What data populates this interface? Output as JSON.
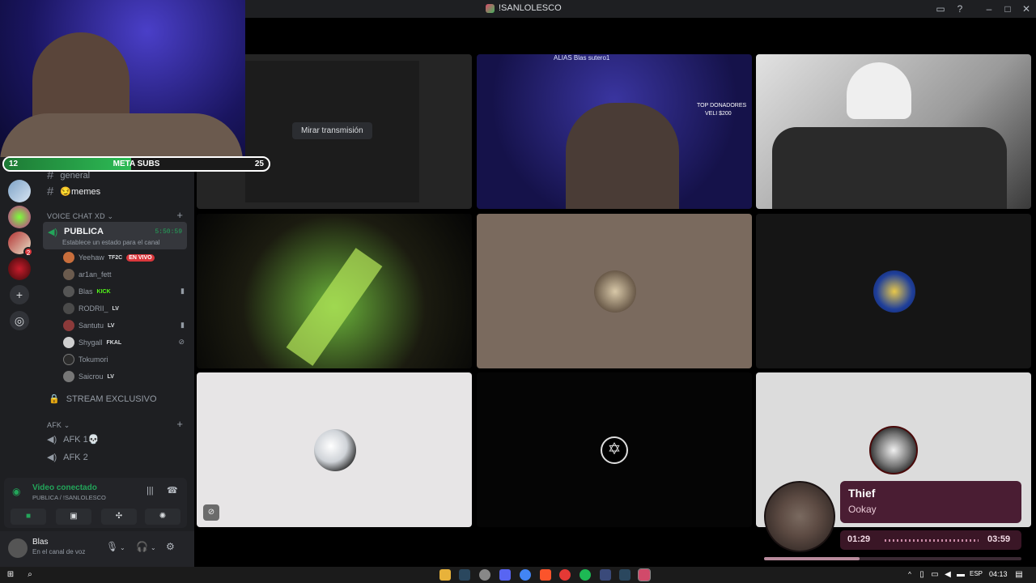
{
  "window": {
    "title": "!SANLOLESCO"
  },
  "overlay": {
    "meta_label": "META SUBS",
    "meta_current": "12",
    "meta_goal": "25",
    "meta_progress": 0.48
  },
  "channels": {
    "text": [
      {
        "label": "general"
      },
      {
        "label": "😏memes"
      }
    ],
    "voice_category": "VOICE CHAT XD",
    "active_voice": {
      "name": "PUBLICA",
      "time": "5:50:59",
      "status": "Establece un estado para el canal"
    },
    "members": [
      {
        "name": "Yeehaw",
        "tag": "TF2C",
        "live": "EN VIVO",
        "color": "#c86e3c"
      },
      {
        "name": "ar1an_fett",
        "tag": "",
        "live": "",
        "color": "#6b5b4e"
      },
      {
        "name": "Blas",
        "tag": "KICK",
        "live": "",
        "color": "#555555"
      },
      {
        "name": "RODRII_",
        "tag": "LV",
        "live": "",
        "color": "#4a4a4a"
      },
      {
        "name": "Santutu",
        "tag": "LV",
        "live": "",
        "color": "#8b3a3a"
      },
      {
        "name": "Shygall",
        "tag": "FKAL",
        "live": "",
        "color": "#cfcfcf"
      },
      {
        "name": "Tokumori",
        "tag": "",
        "live": "",
        "color": "#2b2b2b"
      },
      {
        "name": "Saicrou",
        "tag": "LV",
        "live": "",
        "color": "#777777"
      }
    ],
    "locked_channel": "STREAM EXCLUSIVO",
    "afk_category": "AFK",
    "afk_channels": [
      "AFK 1💀",
      "AFK 2"
    ]
  },
  "voice_panel": {
    "status": "Video conectado",
    "location": "PUBLICA / !SANLOLESCO"
  },
  "user": {
    "name": "Blas",
    "status": "En el canal de voz"
  },
  "stage": {
    "watch_stream_label": "Mirar transmisión",
    "cam_overlay_top": "ALIAS Blas sutero1",
    "cam_overlay_donors": "TOP DONADORES",
    "cam_overlay_amount": "VELI $200"
  },
  "now_playing": {
    "title": "Thief",
    "artist": "Ookay",
    "elapsed": "01:29",
    "duration": "03:59",
    "progress": 0.37
  },
  "taskbar": {
    "lang": "ESP",
    "time": "04:13"
  },
  "colors": {
    "discord_bg": "#1e1f22",
    "accent_green": "#23a55a",
    "live_red": "#da373c",
    "music_card": "#4a1d33"
  }
}
